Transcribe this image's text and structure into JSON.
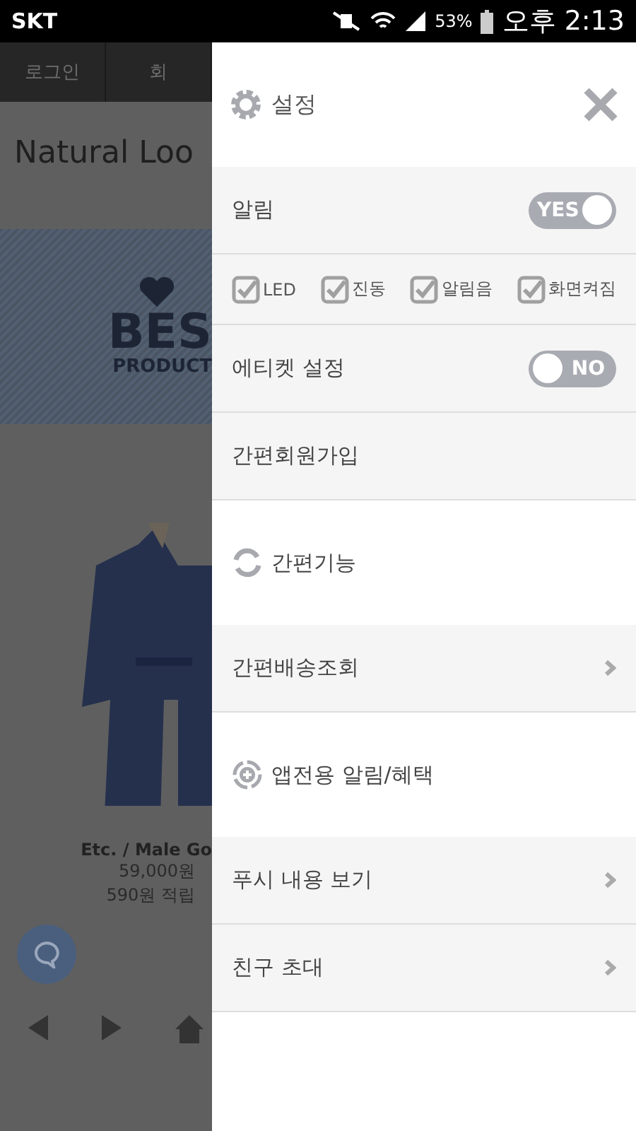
{
  "status_bar": {
    "carrier": "SKT",
    "battery": "53%",
    "time": "오후 2:13"
  },
  "background": {
    "nav": [
      "로그인",
      "회"
    ],
    "title": "Natural Loo",
    "banner": {
      "title": "BES",
      "subtitle": "PRODUCT"
    },
    "product": {
      "name": "Etc. / Male Go",
      "price": "59,000원",
      "points": "590원 적립"
    }
  },
  "drawer": {
    "title": "설정",
    "rows": [
      {
        "kind": "toggle",
        "label": "알림",
        "on": true,
        "toggle_text": "YES"
      },
      {
        "kind": "checks",
        "options": [
          {
            "label": "LED",
            "checked": true
          },
          {
            "label": "진동",
            "checked": true
          },
          {
            "label": "알림음",
            "checked": true
          },
          {
            "label": "화면켜짐",
            "checked": true
          }
        ]
      },
      {
        "kind": "toggle",
        "label": "에티켓 설정",
        "on": false,
        "toggle_text": "NO"
      },
      {
        "kind": "plain",
        "label": "간편회원가입"
      },
      {
        "kind": "section",
        "label": "간편기능"
      },
      {
        "kind": "link",
        "label": "간편배송조회"
      },
      {
        "kind": "section",
        "label": "앱전용 알림/혜택"
      },
      {
        "kind": "link",
        "label": "푸시 내용 보기"
      },
      {
        "kind": "link",
        "label": "친구 초대"
      }
    ]
  }
}
